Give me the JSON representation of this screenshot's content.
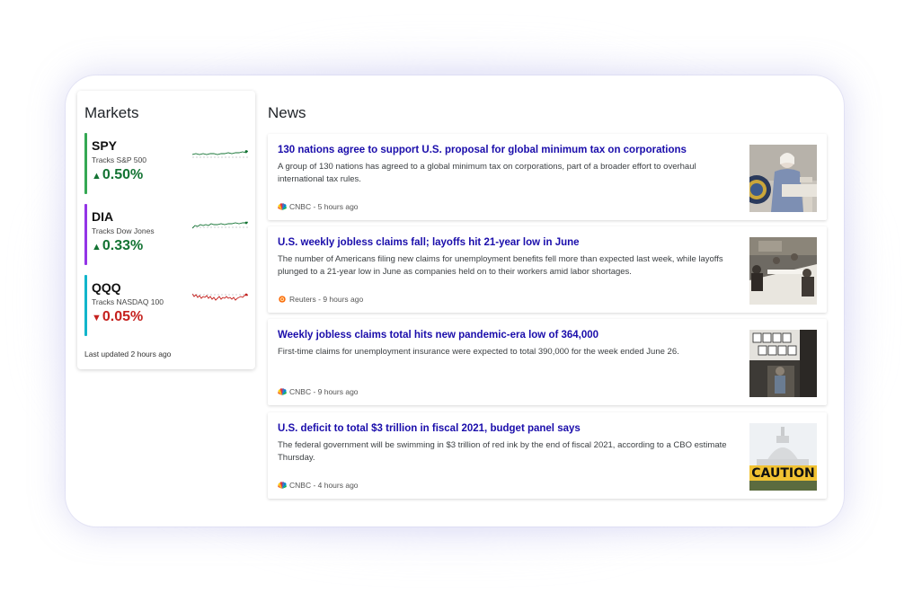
{
  "markets": {
    "title": "Markets",
    "last_updated": "Last updated 2 hours ago",
    "tickers": [
      {
        "symbol": "SPY",
        "description": "Tracks S&P 500",
        "change": "0.50%",
        "direction": "up",
        "color": "#34a853"
      },
      {
        "symbol": "DIA",
        "description": "Tracks Dow Jones",
        "change": "0.33%",
        "direction": "up",
        "color": "#9334e6"
      },
      {
        "symbol": "QQQ",
        "description": "Tracks NASDAQ 100",
        "change": "0.05%",
        "direction": "down",
        "color": "#12b5cb"
      }
    ]
  },
  "news": {
    "title": "News",
    "articles": [
      {
        "headline": "130 nations agree to support U.S. proposal for global minimum tax on corporations",
        "summary": "A group of 130 nations has agreed to a global minimum tax on corporations, part of a broader effort to overhaul international tax rules.",
        "source": "CNBC - 5 hours ago",
        "source_icon": "cnbc-peacock-icon"
      },
      {
        "headline": "U.S. weekly jobless claims fall; layoffs hit 21-year low in June",
        "summary": "The number of Americans filing new claims for unemployment benefits fell more than expected last week, while layoffs plunged to a 21-year low in June as companies held on to their workers amid labor shortages.",
        "source": "Reuters - 9 hours ago",
        "source_icon": "reuters-icon"
      },
      {
        "headline": "Weekly jobless claims total hits new pandemic-era low of 364,000",
        "summary": "First-time claims for unemployment insurance were expected to total 390,000 for the week ended June 26.",
        "source": "CNBC - 9 hours ago",
        "source_icon": "cnbc-peacock-icon"
      },
      {
        "headline": "U.S. deficit to total $3 trillion in fiscal 2021, budget panel says",
        "summary": "The federal government will be swimming in $3 trillion of red ink by the end of fiscal 2021, according to a CBO estimate Thursday.",
        "source": "CNBC - 4 hours ago",
        "source_icon": "cnbc-peacock-icon",
        "image_text": "CAUTION"
      }
    ]
  }
}
